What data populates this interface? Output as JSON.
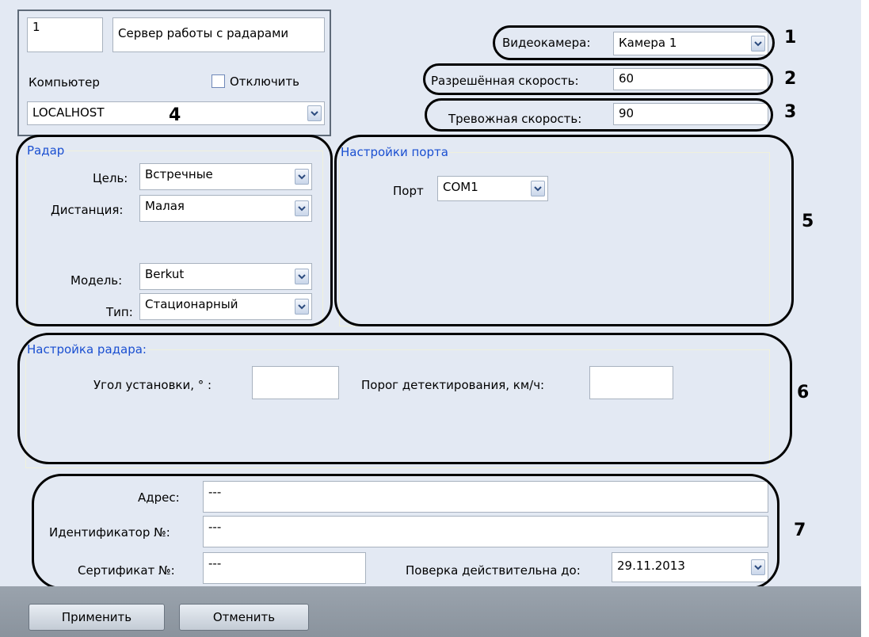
{
  "server": {
    "id": "1",
    "name": "Сервер работы с радарами"
  },
  "computer": {
    "label": "Компьютер",
    "disable_label": "Отключить",
    "value": "LOCALHOST"
  },
  "camera": {
    "label": "Видеокамера:",
    "value": "Камера 1"
  },
  "allowed_speed": {
    "label": "Разрешённая скорость:",
    "value": "60"
  },
  "alarm_speed": {
    "label": "Тревожная скорость:",
    "value": "90"
  },
  "radar": {
    "title": "Радар",
    "target_label": "Цель:",
    "target_value": "Встречные",
    "distance_label": "Дистанция:",
    "distance_value": "Малая",
    "model_label": "Модель:",
    "model_value": "Berkut",
    "type_label": "Тип:",
    "type_value": "Стационарный"
  },
  "port": {
    "title": "Настройки порта",
    "label": "Порт",
    "value": "COM1"
  },
  "radar_setup": {
    "title": "Настройка радара:",
    "angle_label": "Угол установки, ° :",
    "angle_value": "",
    "threshold_label": "Порог детектирования, км/ч:",
    "threshold_value": ""
  },
  "info": {
    "address_label": "Адрес:",
    "address_value": "---",
    "id_label": "Идентификатор №:",
    "id_value": "---",
    "cert_label": "Сертификат №:",
    "cert_value": "---",
    "verify_label": "Поверка действительна до:",
    "verify_value": "29.11.2013"
  },
  "annotations": [
    "1",
    "2",
    "3",
    "4",
    "5",
    "6",
    "7"
  ],
  "buttons": {
    "apply": "Применить",
    "cancel": "Отменить"
  },
  "icons": {
    "dropdown": "chevron-down-icon"
  },
  "colors": {
    "panel": "#e3e9f3",
    "group_title": "#1a4fd1",
    "bottom_bar": "#8a939d"
  }
}
